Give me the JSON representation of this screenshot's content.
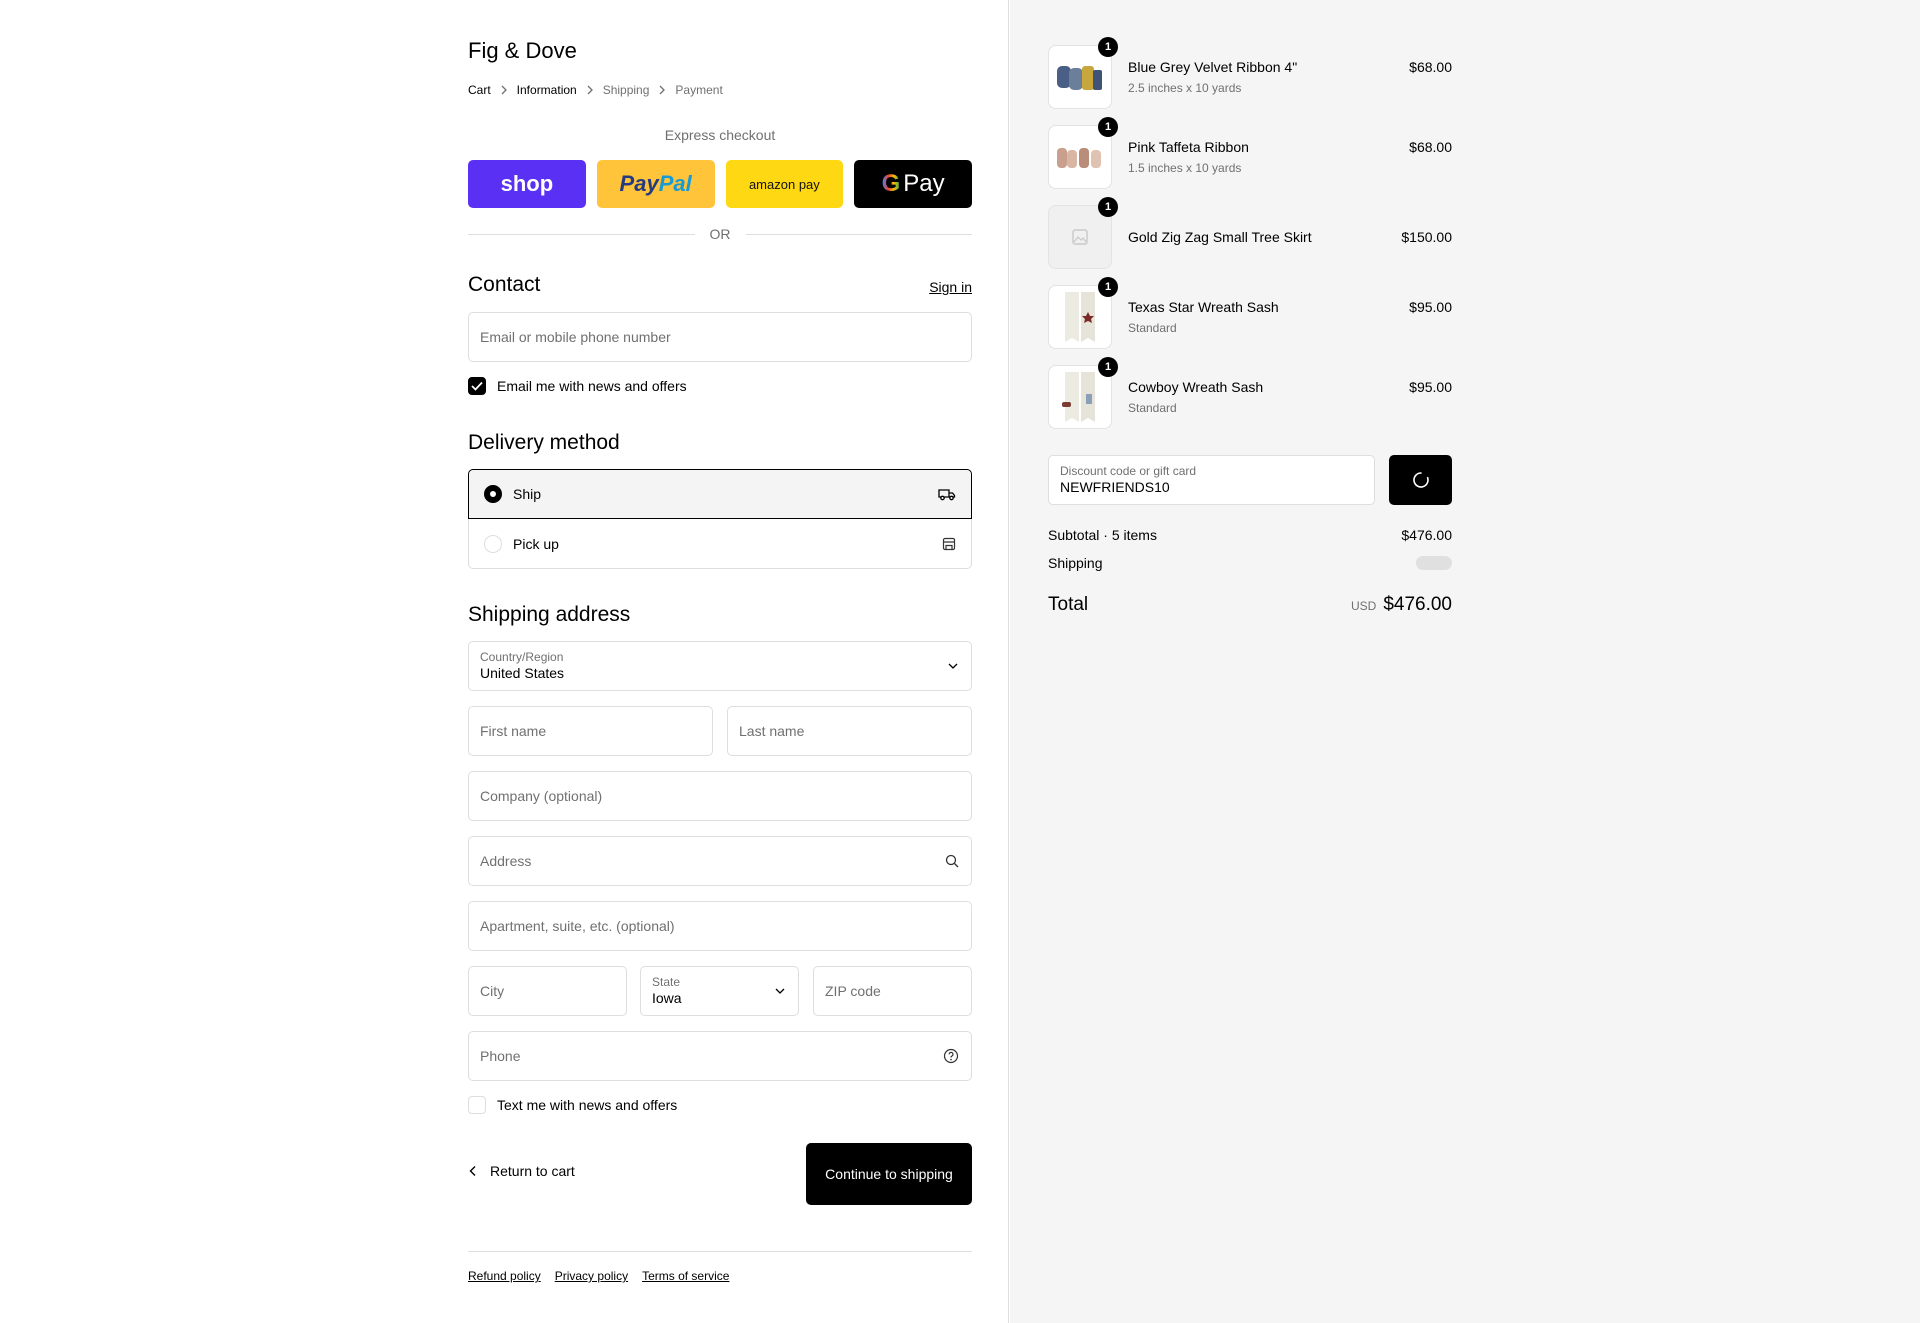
{
  "store": {
    "name": "Fig & Dove"
  },
  "breadcrumb": [
    "Cart",
    "Information",
    "Shipping",
    "Payment"
  ],
  "express": {
    "title": "Express checkout",
    "buttons": {
      "shop": "shop",
      "paypal_a": "Pay",
      "paypal_b": "Pal",
      "amazon": "amazon pay",
      "gpay_g": "G",
      "gpay": "Pay"
    },
    "or": "OR"
  },
  "contact": {
    "title": "Contact",
    "signin": "Sign in",
    "email_placeholder": "Email or mobile phone number",
    "news_label": "Email me with news and offers",
    "news_checked": true
  },
  "delivery": {
    "title": "Delivery method",
    "options": [
      {
        "label": "Ship",
        "selected": true,
        "icon": "truck-icon"
      },
      {
        "label": "Pick up",
        "selected": false,
        "icon": "store-icon"
      }
    ]
  },
  "shipping": {
    "title": "Shipping address",
    "country_label": "Country/Region",
    "country_value": "United States",
    "first_name": "First name",
    "last_name": "Last name",
    "company": "Company (optional)",
    "address": "Address",
    "apartment": "Apartment, suite, etc. (optional)",
    "city": "City",
    "state_label": "State",
    "state_value": "Iowa",
    "zip": "ZIP code",
    "phone": "Phone",
    "text_label": "Text me with news and offers"
  },
  "actions": {
    "return": "Return to cart",
    "continue": "Continue to shipping"
  },
  "footer": {
    "refund": "Refund policy",
    "privacy": "Privacy policy",
    "terms": "Terms of service"
  },
  "summary": {
    "items": [
      {
        "name": "Blue Grey Velvet Ribbon 4\"",
        "variant": "2.5 inches x 10 yards",
        "price": "$68.00",
        "qty": "1"
      },
      {
        "name": "Pink Taffeta Ribbon",
        "variant": "1.5 inches x 10 yards",
        "price": "$68.00",
        "qty": "1"
      },
      {
        "name": "Gold Zig Zag Small Tree Skirt",
        "variant": "",
        "price": "$150.00",
        "qty": "1"
      },
      {
        "name": "Texas Star Wreath Sash",
        "variant": "Standard",
        "price": "$95.00",
        "qty": "1"
      },
      {
        "name": "Cowboy Wreath Sash",
        "variant": "Standard",
        "price": "$95.00",
        "qty": "1"
      }
    ],
    "discount_label": "Discount code or gift card",
    "discount_value": "NEWFRIENDS10",
    "subtotal_label": "Subtotal · 5 items",
    "subtotal_value": "$476.00",
    "shipping_label": "Shipping",
    "total_label": "Total",
    "currency": "USD",
    "total_value": "$476.00"
  },
  "colors": {
    "accent": "#000000",
    "shop": "#5a31f4",
    "paypal": "#ffc439",
    "amazon": "#ffd814",
    "summary_bg": "#f5f5f5"
  }
}
